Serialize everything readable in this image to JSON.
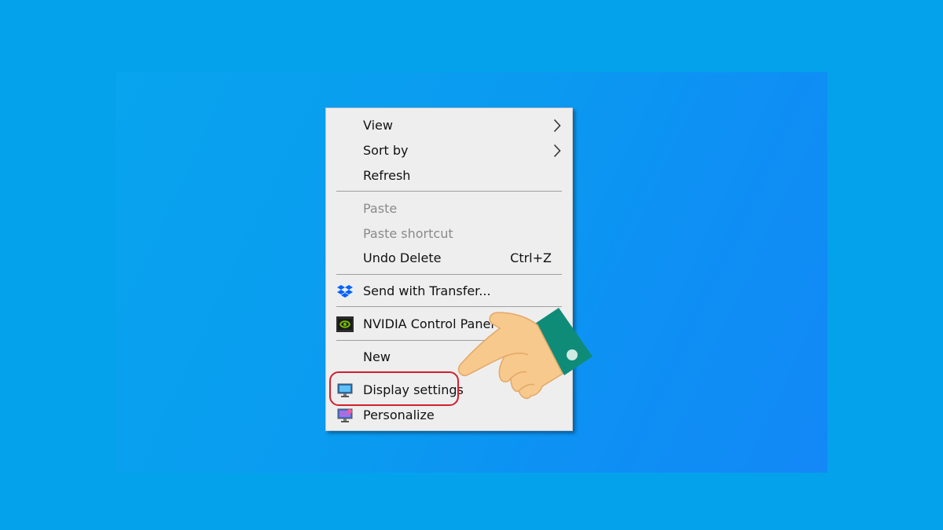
{
  "menu": {
    "view": "View",
    "sort_by": "Sort by",
    "refresh": "Refresh",
    "paste": "Paste",
    "paste_shortcut": "Paste shortcut",
    "undo_delete": "Undo Delete",
    "undo_delete_shortcut": "Ctrl+Z",
    "send_with_transfer": "Send with Transfer...",
    "nvidia_control_panel": "NVIDIA Control Panel",
    "new": "New",
    "display_settings": "Display settings",
    "personalize": "Personalize"
  },
  "icons": {
    "dropbox": "dropbox-icon",
    "nvidia": "nvidia-icon",
    "display": "display-icon",
    "personalize": "personalize-icon",
    "submenu": "chevron-right-icon",
    "pointer": "pointing-hand-icon"
  },
  "colors": {
    "desktop": "#05a2ec",
    "menu_background": "#eeeeee",
    "highlight_border": "#d1202f",
    "sleeve": "#0e8c78",
    "skin": "#f7c98c"
  }
}
